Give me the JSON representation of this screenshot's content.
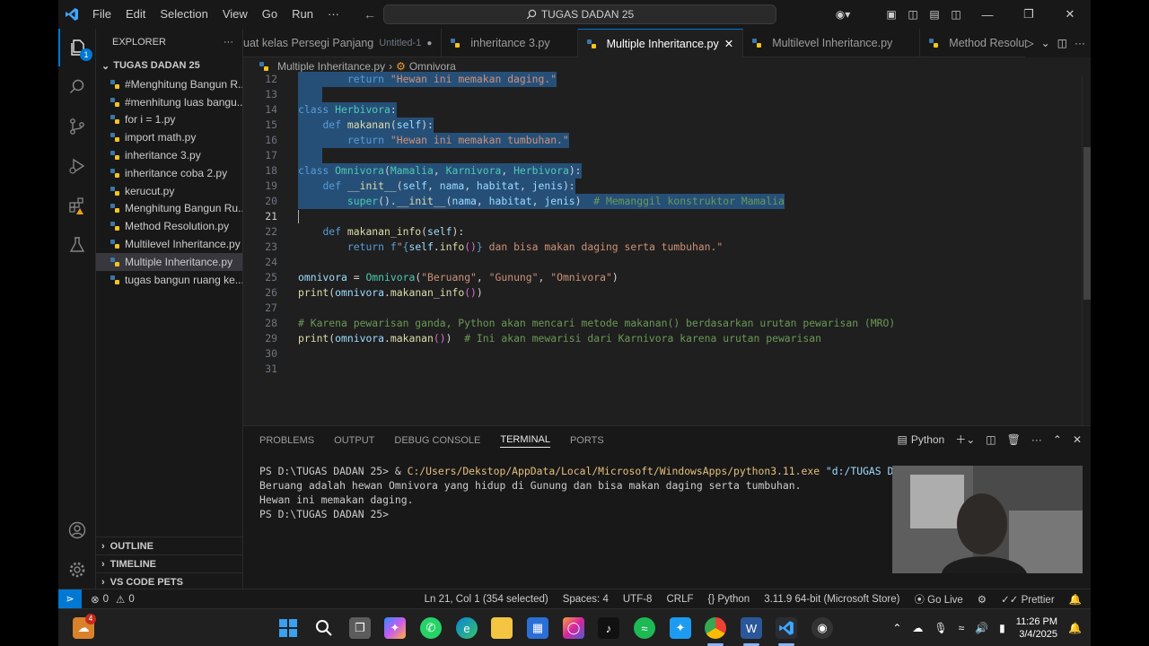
{
  "titlebar": {
    "menu": [
      "File",
      "Edit",
      "Selection",
      "View",
      "Go",
      "Run",
      "···"
    ],
    "search": "TUGAS DADAN 25"
  },
  "explorer": {
    "title": "EXPLORER",
    "folder": "TUGAS DADAN 25",
    "files": [
      "#Menghitung Bangun R...",
      "#menhitung luas bangu...",
      "for i = 1.py",
      "import math.py",
      "inheritance 3.py",
      "inheritance coba 2.py",
      "kerucut.py",
      "Menghitung Bangun Ru...",
      "Method Resolution.py",
      "Multilevel Inheritance.py",
      "Multiple Inheritance.py",
      "tugas bangun ruang ke..."
    ],
    "selected_index": 10,
    "sections": [
      "OUTLINE",
      "TIMELINE",
      "VS CODE PETS"
    ]
  },
  "tabs": [
    {
      "label": "uat kelas Persegi Panjang",
      "extra": "Untitled-1",
      "modified": true
    },
    {
      "label": "inheritance 3.py",
      "extra": "",
      "modified": false
    },
    {
      "label": "Multiple Inheritance.py",
      "extra": "",
      "modified": false,
      "active": true
    },
    {
      "label": "Multilevel Inheritance.py",
      "extra": "",
      "modified": false
    },
    {
      "label": "Method Resolution.py",
      "extra": "",
      "modified": false
    }
  ],
  "breadcrumb": {
    "file": "Multiple Inheritance.py",
    "separator": "›",
    "symbol": "Omnivora"
  },
  "editor": {
    "current_line": 21,
    "lines": [
      {
        "n": 12,
        "sel": true,
        "tokens": [
          [
            "tx",
            "        "
          ],
          [
            "kw",
            "return"
          ],
          [
            "tx",
            " "
          ],
          [
            "str",
            "\"Hewan ini memakan daging.\""
          ]
        ]
      },
      {
        "n": 13,
        "sel": true,
        "tokens": [
          [
            "tx",
            "    "
          ]
        ]
      },
      {
        "n": 14,
        "sel": true,
        "tokens": [
          [
            "kw",
            "class"
          ],
          [
            "tx",
            " "
          ],
          [
            "cls",
            "Herbivora"
          ],
          [
            "tx",
            ":"
          ]
        ]
      },
      {
        "n": 15,
        "sel": true,
        "tokens": [
          [
            "tx",
            "    "
          ],
          [
            "kw",
            "def"
          ],
          [
            "tx",
            " "
          ],
          [
            "fn",
            "makanan"
          ],
          [
            "tx",
            "("
          ],
          [
            "sf",
            "self"
          ],
          [
            "tx",
            "):"
          ]
        ]
      },
      {
        "n": 16,
        "sel": true,
        "tokens": [
          [
            "tx",
            "        "
          ],
          [
            "kw",
            "return"
          ],
          [
            "tx",
            " "
          ],
          [
            "str",
            "\"Hewan ini memakan tumbuhan.\""
          ]
        ]
      },
      {
        "n": 17,
        "sel": true,
        "tokens": [
          [
            "tx",
            "    "
          ]
        ]
      },
      {
        "n": 18,
        "sel": true,
        "tokens": [
          [
            "kw",
            "class"
          ],
          [
            "tx",
            " "
          ],
          [
            "cls",
            "Omnivora"
          ],
          [
            "tx",
            "("
          ],
          [
            "cls",
            "Mamalia"
          ],
          [
            "tx",
            ", "
          ],
          [
            "cls",
            "Karnivora"
          ],
          [
            "tx",
            ", "
          ],
          [
            "cls",
            "Herbivora"
          ],
          [
            "tx",
            "):"
          ]
        ]
      },
      {
        "n": 19,
        "sel": true,
        "tokens": [
          [
            "tx",
            "    "
          ],
          [
            "kw",
            "def"
          ],
          [
            "tx",
            " "
          ],
          [
            "fn",
            "__init__"
          ],
          [
            "tx",
            "("
          ],
          [
            "sf",
            "self"
          ],
          [
            "tx",
            ", "
          ],
          [
            "var",
            "nama"
          ],
          [
            "tx",
            ", "
          ],
          [
            "var",
            "habitat"
          ],
          [
            "tx",
            ", "
          ],
          [
            "var",
            "jenis"
          ],
          [
            "tx",
            "):"
          ]
        ]
      },
      {
        "n": 20,
        "sel": true,
        "tokens": [
          [
            "tx",
            "        "
          ],
          [
            "cls",
            "super"
          ],
          [
            "tx",
            "()."
          ],
          [
            "fn",
            "__init__"
          ],
          [
            "tx",
            "("
          ],
          [
            "var",
            "nama"
          ],
          [
            "tx",
            ", "
          ],
          [
            "var",
            "habitat"
          ],
          [
            "tx",
            ", "
          ],
          [
            "var",
            "jenis"
          ],
          [
            "tx",
            ")  "
          ],
          [
            "cm",
            "# Memanggil konstruktor Mamalia"
          ]
        ]
      },
      {
        "n": 21,
        "sel": false,
        "tokens": []
      },
      {
        "n": 22,
        "sel": false,
        "tokens": [
          [
            "tx",
            "    "
          ],
          [
            "kw",
            "def"
          ],
          [
            "tx",
            " "
          ],
          [
            "fn",
            "makanan_info"
          ],
          [
            "tx",
            "("
          ],
          [
            "sf",
            "self"
          ],
          [
            "tx",
            "):"
          ]
        ]
      },
      {
        "n": 23,
        "sel": false,
        "tokens": [
          [
            "tx",
            "        "
          ],
          [
            "kw",
            "return"
          ],
          [
            "tx",
            " "
          ],
          [
            "kw",
            "f"
          ],
          [
            "str",
            "\""
          ],
          [
            "kw",
            "{"
          ],
          [
            "sf",
            "self"
          ],
          [
            "tx",
            "."
          ],
          [
            "fn",
            "info"
          ],
          [
            "br",
            "()"
          ],
          [
            "kw",
            "}"
          ],
          [
            "str",
            " dan bisa makan daging serta tumbuhan.\""
          ]
        ]
      },
      {
        "n": 24,
        "sel": false,
        "tokens": []
      },
      {
        "n": 25,
        "sel": false,
        "tokens": [
          [
            "var",
            "omnivora"
          ],
          [
            "tx",
            " = "
          ],
          [
            "cls",
            "Omnivora"
          ],
          [
            "tx",
            "("
          ],
          [
            "str",
            "\"Beruang\""
          ],
          [
            "tx",
            ", "
          ],
          [
            "str",
            "\"Gunung\""
          ],
          [
            "tx",
            ", "
          ],
          [
            "str",
            "\"Omnivora\""
          ],
          [
            "tx",
            ")"
          ]
        ]
      },
      {
        "n": 26,
        "sel": false,
        "tokens": [
          [
            "fn",
            "print"
          ],
          [
            "tx",
            "("
          ],
          [
            "var",
            "omnivora"
          ],
          [
            "tx",
            "."
          ],
          [
            "fn",
            "makanan_info"
          ],
          [
            "br",
            "()"
          ],
          [
            "tx",
            ")"
          ]
        ]
      },
      {
        "n": 27,
        "sel": false,
        "tokens": []
      },
      {
        "n": 28,
        "sel": false,
        "tokens": [
          [
            "cm",
            "# Karena pewarisan ganda, Python akan mencari metode makanan() berdasarkan urutan pewarisan (MRO)"
          ]
        ]
      },
      {
        "n": 29,
        "sel": false,
        "tokens": [
          [
            "fn",
            "print"
          ],
          [
            "tx",
            "("
          ],
          [
            "var",
            "omnivora"
          ],
          [
            "tx",
            "."
          ],
          [
            "fn",
            "makanan"
          ],
          [
            "br",
            "()"
          ],
          [
            "tx",
            ")  "
          ],
          [
            "cm",
            "# Ini akan mewarisi dari Karnivora karena urutan pewarisan"
          ]
        ]
      },
      {
        "n": 30,
        "sel": false,
        "tokens": []
      },
      {
        "n": 31,
        "sel": false,
        "tokens": []
      }
    ]
  },
  "panel": {
    "tabs": [
      "PROBLEMS",
      "OUTPUT",
      "DEBUG CONSOLE",
      "TERMINAL",
      "PORTS"
    ],
    "active_tab": "TERMINAL",
    "shell_label": "Python",
    "terminal": {
      "prompt1": "PS D:\\TUGAS DADAN 25> & ",
      "exe": "C:/Users/Dekstop/AppData/Local/Microsoft/WindowsApps/python3.11.exe",
      "arg": " \"d:/TUGAS DADAN",
      "out1": "Beruang adalah hewan Omnivora yang hidup di Gunung dan bisa makan daging serta tumbuhan.",
      "out2": "Hewan ini memakan daging.",
      "prompt2": "PS D:\\TUGAS DADAN 25> "
    }
  },
  "statusbar": {
    "errors": "0",
    "warnings": "0",
    "position": "Ln 21, Col 1 (354 selected)",
    "spaces": "Spaces: 4",
    "encoding": "UTF-8",
    "eol": "CRLF",
    "language_prefix": "{}",
    "language": "Python",
    "interpreter": "3.11.9 64-bit (Microsoft Store)",
    "golive": "Go Live",
    "prettier": "Prettier"
  },
  "taskbar": {
    "time": "11:26 PM",
    "date": "3/4/2025",
    "weather_badge": "4"
  },
  "colors": {
    "accent": "#0078d4",
    "selection": "#264f78",
    "editor_bg": "#1f1f1f",
    "chrome_bg": "#181818"
  }
}
